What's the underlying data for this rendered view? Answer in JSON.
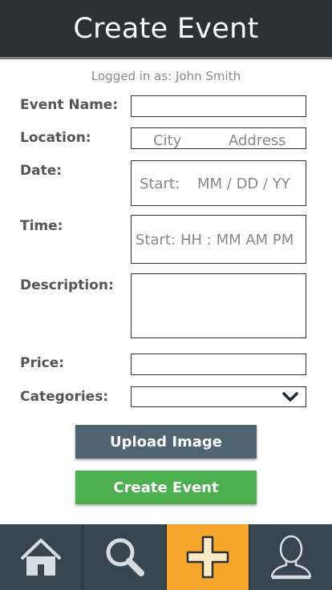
{
  "header": {
    "title": "Create Event"
  },
  "session": {
    "logged_in_text": "Logged in as: John Smith"
  },
  "form": {
    "event_name": {
      "label": "Event Name:",
      "value": ""
    },
    "location": {
      "label": "Location:",
      "city_placeholder": "City",
      "address_placeholder": "Address"
    },
    "date": {
      "label": "Date:",
      "start_label": "Start:",
      "placeholder": "MM / DD / YY"
    },
    "time": {
      "label": "Time:",
      "start_label": "Start:",
      "placeholder": "HH : MM AM PM"
    },
    "description": {
      "label": "Description:",
      "value": ""
    },
    "price": {
      "label": "Price:",
      "value": ""
    },
    "categories": {
      "label": "Categories:",
      "selected": ""
    }
  },
  "buttons": {
    "upload": "Upload Image",
    "create": "Create Event"
  },
  "nav": {
    "active": "add",
    "items": [
      {
        "id": "home",
        "icon": "home-icon"
      },
      {
        "id": "search",
        "icon": "search-icon"
      },
      {
        "id": "add",
        "icon": "plus-icon"
      },
      {
        "id": "profile",
        "icon": "user-icon"
      }
    ]
  },
  "colors": {
    "header_bg": "#2b3135",
    "nav_bg": "#36454f",
    "nav_active": "#f6a62b",
    "upload_button": "#4e6470",
    "create_button": "#4caf50"
  }
}
